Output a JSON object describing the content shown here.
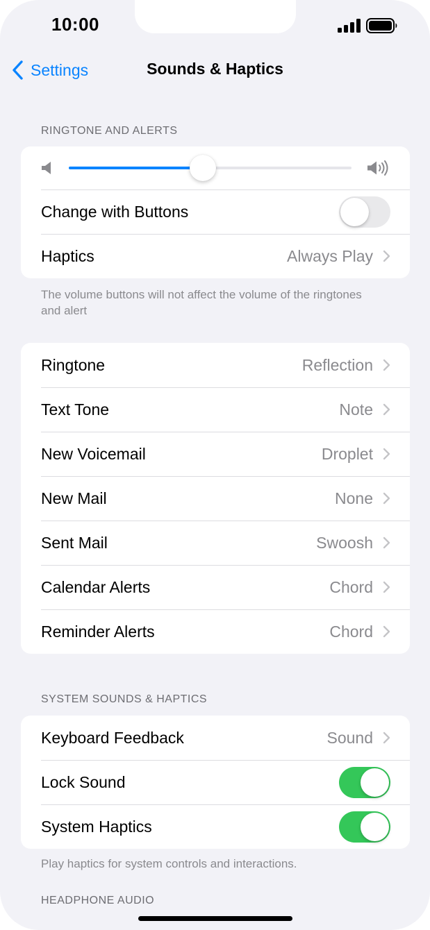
{
  "status_bar": {
    "time": "10:00"
  },
  "nav": {
    "back_label": "Settings",
    "title": "Sounds & Haptics"
  },
  "ringtone_alerts": {
    "header": "RINGTONE AND ALERTS",
    "volume_fraction": 0.475,
    "change_with_buttons": {
      "label": "Change with Buttons",
      "on": false
    },
    "haptics": {
      "label": "Haptics",
      "value": "Always Play"
    },
    "footer": "The volume buttons will not affect the volume of the ringtones and alert"
  },
  "tones": [
    {
      "label": "Ringtone",
      "value": "Reflection"
    },
    {
      "label": "Text Tone",
      "value": "Note"
    },
    {
      "label": "New Voicemail",
      "value": "Droplet"
    },
    {
      "label": "New Mail",
      "value": "None"
    },
    {
      "label": "Sent Mail",
      "value": "Swoosh"
    },
    {
      "label": "Calendar Alerts",
      "value": "Chord"
    },
    {
      "label": "Reminder Alerts",
      "value": "Chord"
    }
  ],
  "system": {
    "header": "SYSTEM SOUNDS & HAPTICS",
    "keyboard_feedback": {
      "label": "Keyboard Feedback",
      "value": "Sound"
    },
    "lock_sound": {
      "label": "Lock Sound",
      "on": true
    },
    "system_haptics": {
      "label": "System Haptics",
      "on": true
    },
    "footer": "Play haptics for system controls and interactions."
  },
  "headphone": {
    "header": "HEADPHONE AUDIO"
  },
  "colors": {
    "accent": "#0a84ff",
    "toggle_on": "#34c759",
    "toggle_off": "#e9e9eb",
    "background": "#f2f2f7"
  }
}
